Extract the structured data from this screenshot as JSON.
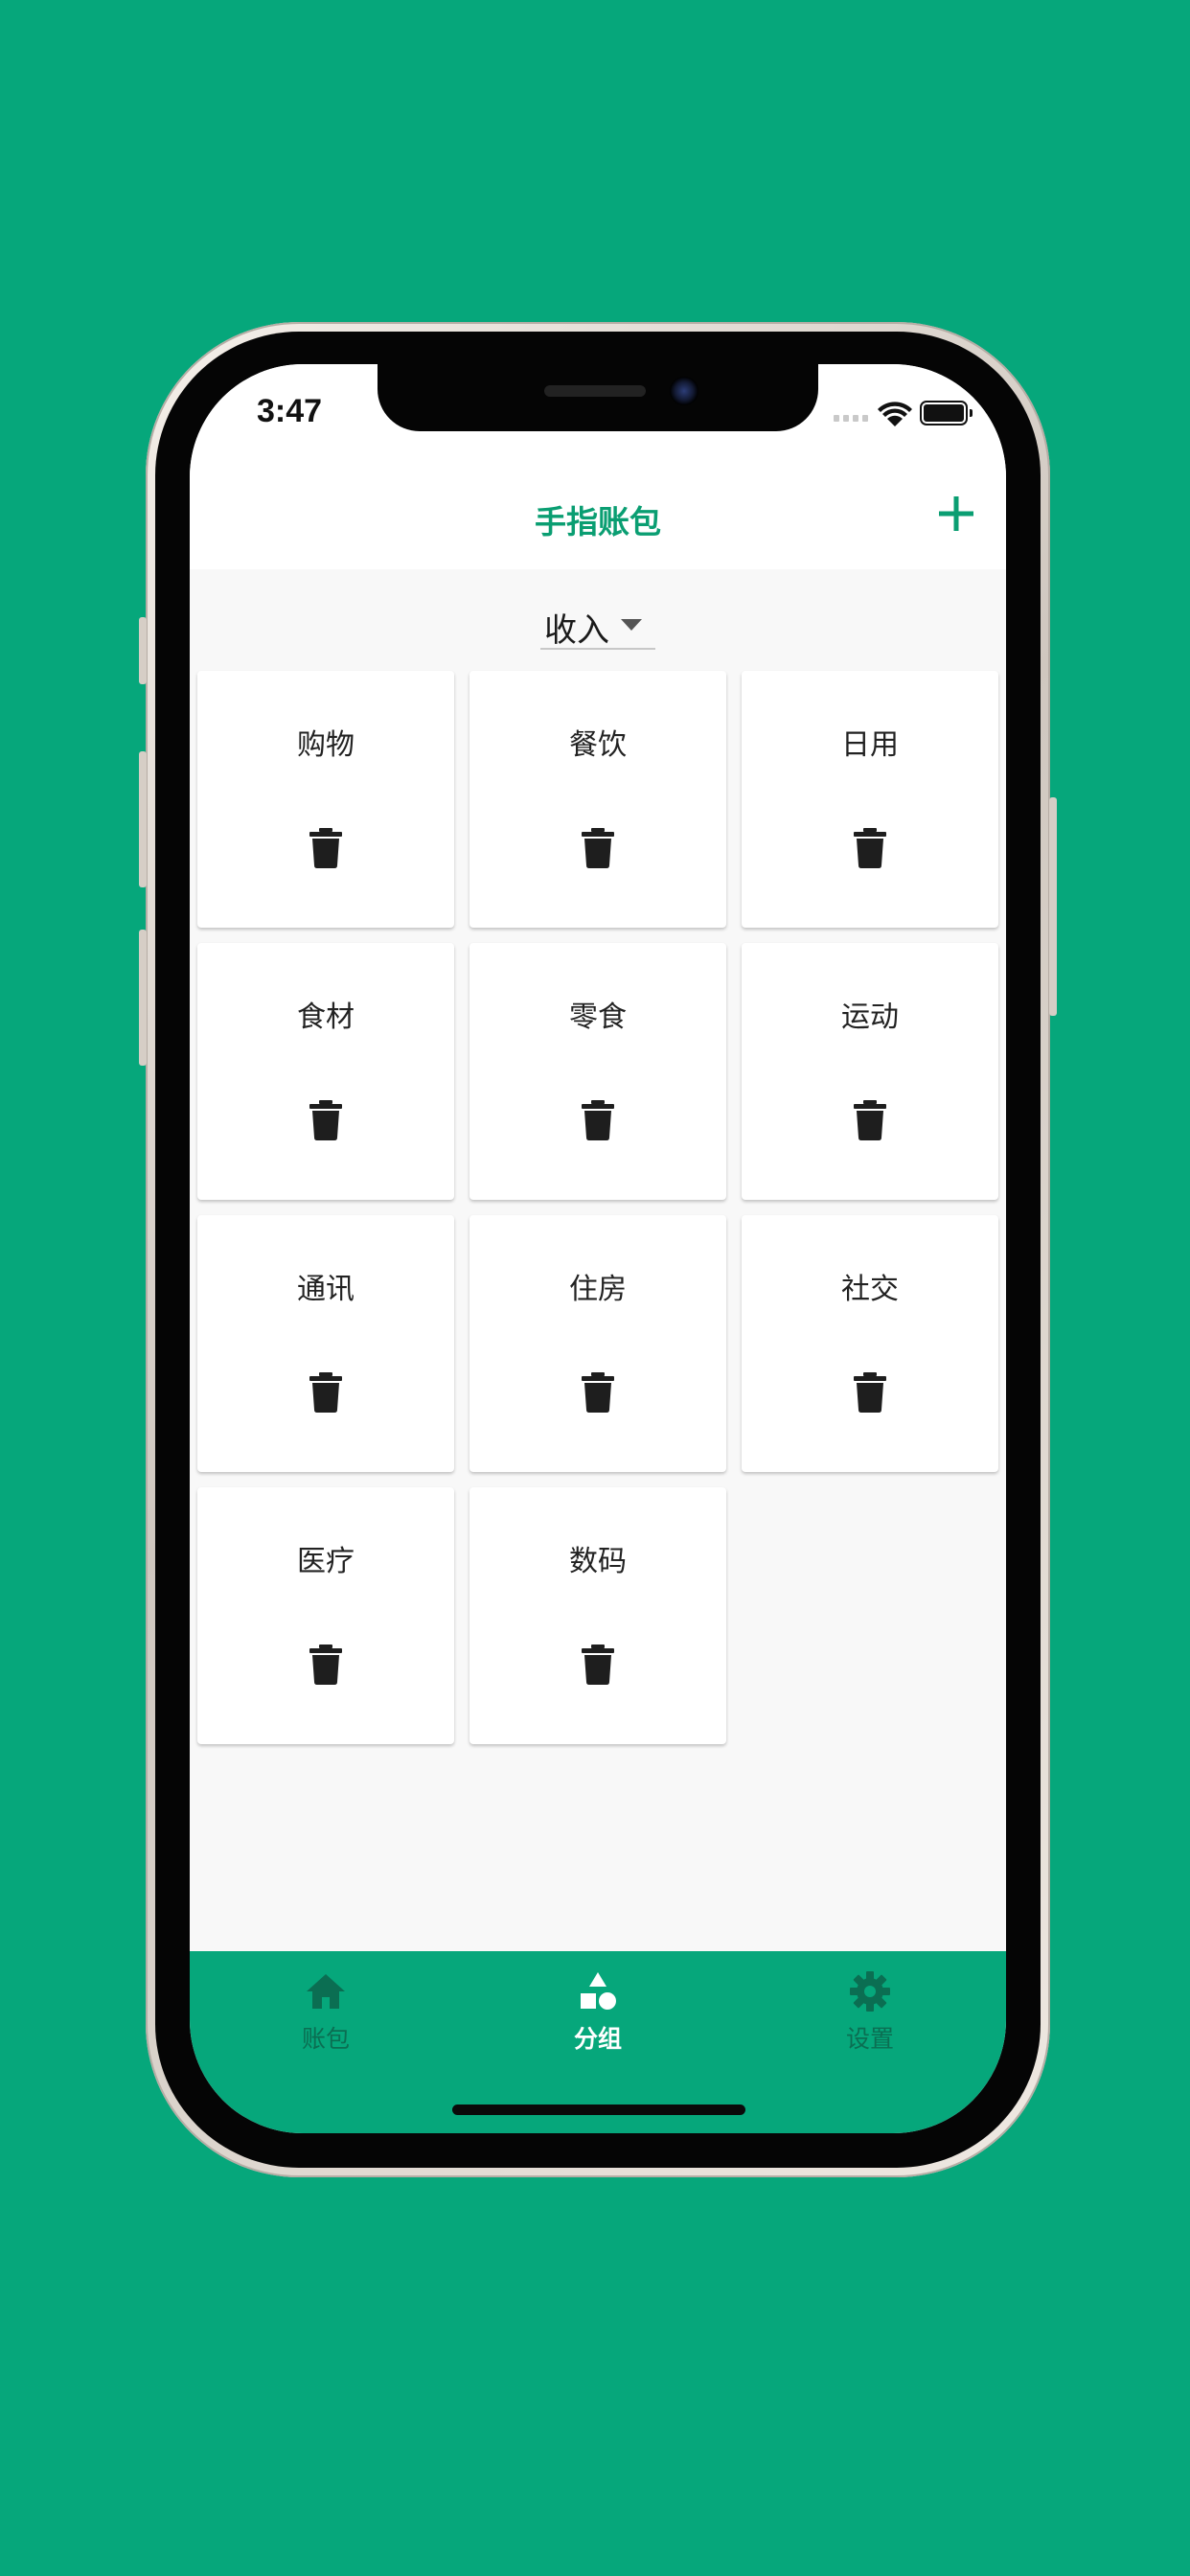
{
  "status_bar": {
    "time": "3:47"
  },
  "header": {
    "title": "手指账包",
    "add_icon": "plus-icon"
  },
  "type_selector": {
    "value": "收入",
    "icon": "caret-down-icon"
  },
  "categories": [
    {
      "name": "购物",
      "delete_icon": "trash-icon"
    },
    {
      "name": "餐饮",
      "delete_icon": "trash-icon"
    },
    {
      "name": "日用",
      "delete_icon": "trash-icon"
    },
    {
      "name": "食材",
      "delete_icon": "trash-icon"
    },
    {
      "name": "零食",
      "delete_icon": "trash-icon"
    },
    {
      "name": "运动",
      "delete_icon": "trash-icon"
    },
    {
      "name": "通讯",
      "delete_icon": "trash-icon"
    },
    {
      "name": "住房",
      "delete_icon": "trash-icon"
    },
    {
      "name": "社交",
      "delete_icon": "trash-icon"
    },
    {
      "name": "医疗",
      "delete_icon": "trash-icon"
    },
    {
      "name": "数码",
      "delete_icon": "trash-icon"
    }
  ],
  "tab_bar": {
    "tabs": [
      {
        "label": "账包",
        "icon": "home-icon",
        "active": false
      },
      {
        "label": "分组",
        "icon": "shapes-icon",
        "active": true
      },
      {
        "label": "设置",
        "icon": "gear-icon",
        "active": false
      }
    ]
  },
  "colors": {
    "background": "#06a77b",
    "accent": "#0a9e72",
    "tab_active": "#ffffff",
    "tab_inactive": "#0b6e52",
    "icon_dark": "#1e1e1e"
  }
}
